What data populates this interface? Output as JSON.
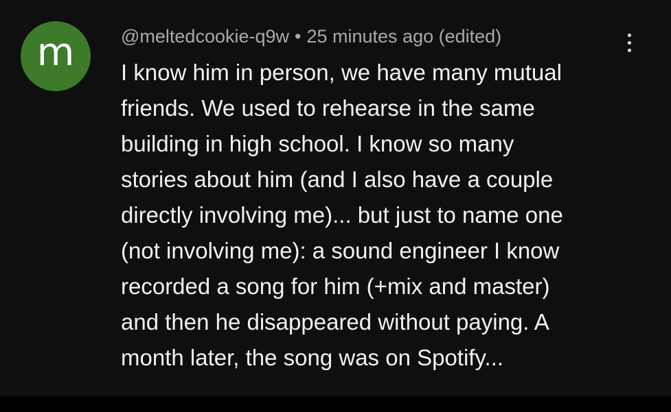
{
  "colors": {
    "background": "#0f0f0f",
    "avatar_bg": "#3d7a2a",
    "text_primary": "#f1f1f1",
    "text_secondary": "#aaaaaa"
  },
  "comment": {
    "avatar_letter": "m",
    "author_handle": "@meltedcookie-q9w",
    "separator": "•",
    "timestamp": "25 minutes ago (edited)",
    "menu_icon": "more-vertical-icon",
    "body_lines": [
      "I know him in person, we have many mutual",
      "friends. We used to rehearse in the same",
      "building in high school. I know so many",
      "stories about him (and I also have a couple",
      "directly involving me)... but just to name one",
      "(not involving me): a sound engineer I know",
      "recorded a song for him (+mix and master)",
      "and then he disappeared without paying. A",
      "month later, the song was on Spotify..."
    ]
  }
}
